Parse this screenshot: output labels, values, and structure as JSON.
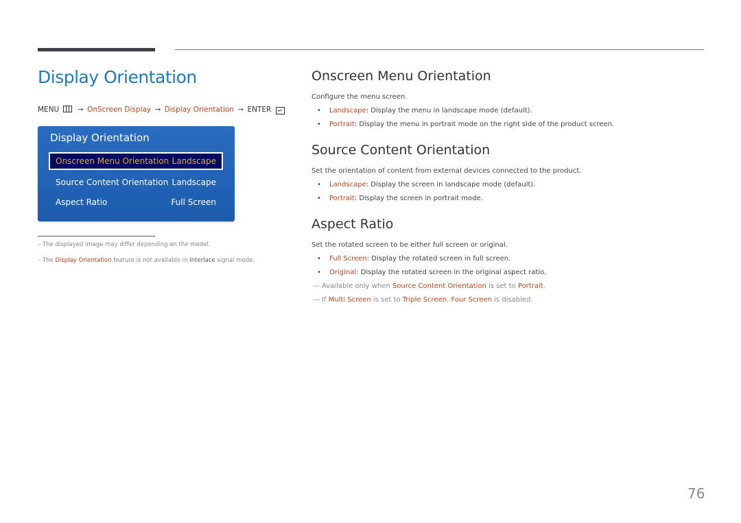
{
  "page": {
    "title": "Display Orientation",
    "page_number": "76"
  },
  "breadcrumb": {
    "menu": "MENU",
    "menu_icon": "menu-grid-icon",
    "arrow": "→",
    "step1": "OnScreen Display",
    "step2": "Display Orientation",
    "enter": "ENTER",
    "enter_icon": "enter-icon",
    "enter_glyph": "↵"
  },
  "osd_menu": {
    "title": "Display Orientation",
    "rows": [
      {
        "label": "Onscreen Menu Orientation",
        "value": "Landscape",
        "selected": true
      },
      {
        "label": "Source Content Orientation",
        "value": "Landscape",
        "selected": false
      },
      {
        "label": "Aspect Ratio",
        "value": "Full Screen",
        "selected": false
      }
    ]
  },
  "notes": {
    "dash": "–",
    "note1": "The displayed image may differ depending on the model.",
    "note2_pre": "The ",
    "note2_hl": "Display Orientation",
    "note2_mid": " feature is not available in ",
    "note2_dk": "Interlace",
    "note2_post": " signal mode."
  },
  "sections": {
    "onscreen": {
      "title": "Onscreen Menu Orientation",
      "desc": "Configure the menu screen.",
      "bullets": [
        {
          "term": "Landscape",
          "text": ": Display the menu in landscape mode (default)."
        },
        {
          "term": "Portrait",
          "text": ": Display the menu in portrait mode on the right side of the product screen."
        }
      ]
    },
    "source": {
      "title": "Source Content Orientation",
      "desc": "Set the orientation of content from external devices connected to the product.",
      "bullets": [
        {
          "term": "Landscape",
          "text": ": Display the screen in landscape mode (default)."
        },
        {
          "term": "Portrait",
          "text": ": Display the screen in portrait mode."
        }
      ]
    },
    "aspect": {
      "title": "Aspect Ratio",
      "desc": "Set the rotated screen to be either full screen or original.",
      "bullets": [
        {
          "term": "Full Screen",
          "text": ": Display the rotated screen in full screen."
        },
        {
          "term": "Original",
          "text": ": Display the rotated screen in the original aspect ratio."
        }
      ],
      "subnote1": {
        "pre": "Available only when ",
        "hl1": "Source Content Orientation",
        "mid": " is set to ",
        "hl2": "Portrait",
        "post": "."
      },
      "subnote2": {
        "pre": "If ",
        "hl1": "Multi Screen",
        "mid": " is set to ",
        "hl2": "Triple Screen",
        "sep": ", ",
        "hl3": "Four Screen",
        "post": " is disabled."
      }
    }
  },
  "bullet_glyph": "•",
  "note_mark": "―",
  "colors": {
    "title_blue": "#1a7bc4",
    "highlight": "#c0441e",
    "osd_blue": "#1e5fb0",
    "osd_selected_bg": "#000a5e",
    "osd_selected_text": "#f2a23a"
  }
}
